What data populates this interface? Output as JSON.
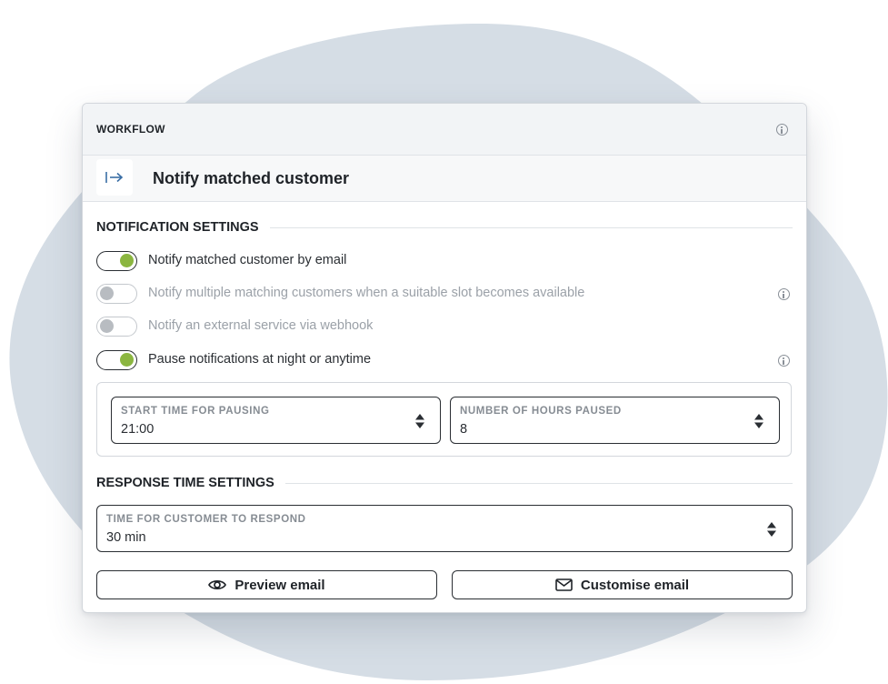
{
  "workflow": {
    "header_label": "WORKFLOW",
    "title": "Notify matched customer"
  },
  "notification_settings": {
    "heading": "NOTIFICATION SETTINGS",
    "toggles": [
      {
        "label": "Notify matched customer by email",
        "enabled": true,
        "info": false
      },
      {
        "label": "Notify multiple matching customers when a suitable slot becomes available",
        "enabled": false,
        "info": true
      },
      {
        "label": "Notify an external service via webhook",
        "enabled": false,
        "info": false
      },
      {
        "label": "Pause notifications at night or anytime",
        "enabled": true,
        "info": true
      }
    ],
    "pause": {
      "start_label": "START TIME FOR PAUSING",
      "start_value": "21:00",
      "hours_label": "NUMBER OF HOURS PAUSED",
      "hours_value": "8"
    }
  },
  "response_settings": {
    "heading": "RESPONSE TIME SETTINGS",
    "respond_label": "TIME FOR CUSTOMER TO RESPOND",
    "respond_value": "30 min"
  },
  "actions": {
    "preview_label": "Preview email",
    "customise_label": "Customise email"
  },
  "colors": {
    "toggle_on": "#8bb640",
    "toggle_off": "#b8bcc1",
    "background_blob": "#d5dde5"
  },
  "icons": {
    "header_info": "info-icon",
    "workflow_step": "arrow-right-from-line-icon",
    "preview": "eye-icon",
    "customise": "envelope-icon"
  }
}
